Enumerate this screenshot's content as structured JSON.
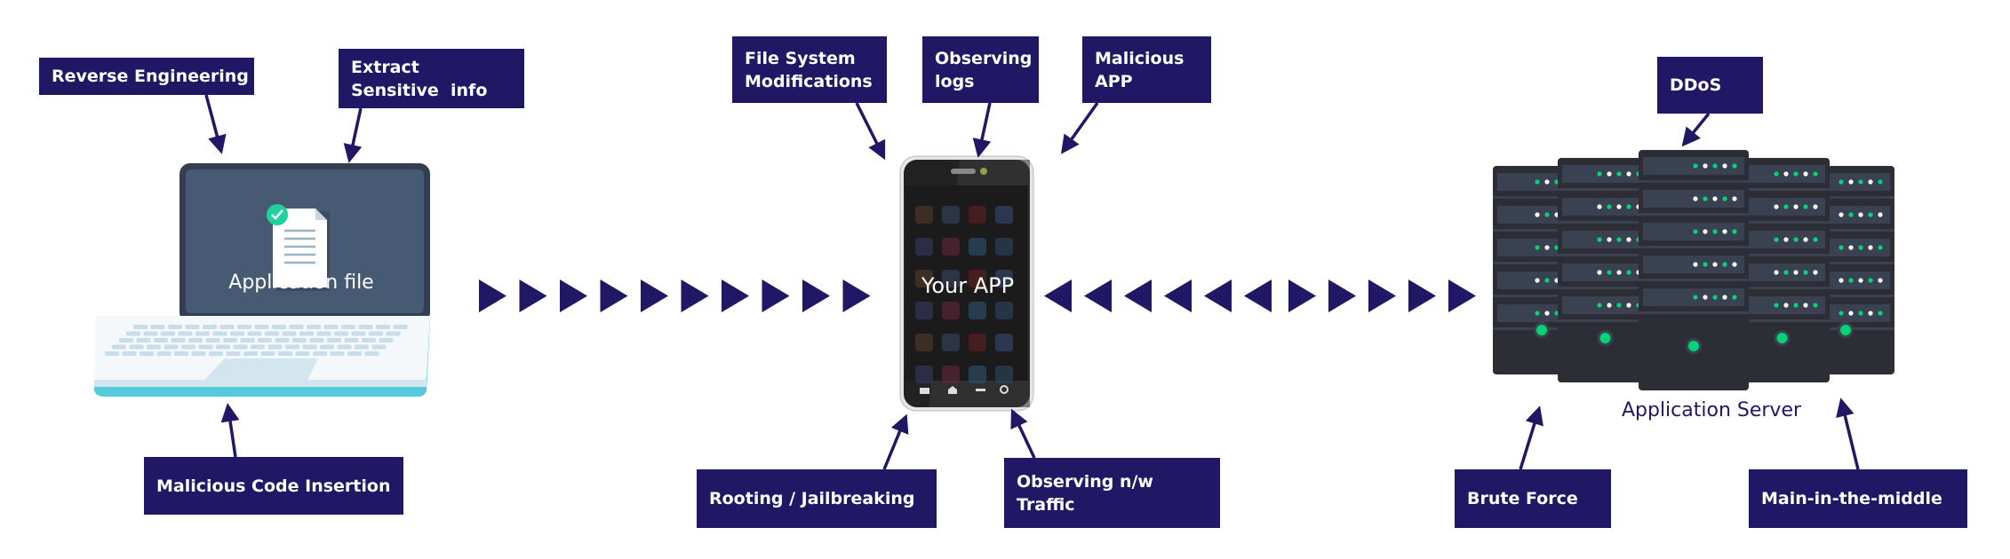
{
  "colors": {
    "label_bg": "#201865",
    "arrow": "#201865",
    "laptop_screen": "#475a73",
    "laptop_frame": "#323f52",
    "laptop_base": "#55cadb",
    "server_body": "#2c2d35",
    "server_led": "#00d474"
  },
  "laptop": {
    "screen_label": "Application file",
    "icons": [
      "document-icon",
      "check-badge-icon"
    ]
  },
  "phone": {
    "screen_label": "Your APP"
  },
  "server": {
    "label": "Application Server"
  },
  "labels": {
    "reverse_engineering": [
      "Reverse Engineering"
    ],
    "extract_info": [
      "Extract",
      "Sensitive  info"
    ],
    "malicious_code": [
      "Malicious Code Insertion"
    ],
    "file_system": [
      "File System",
      "Modifications"
    ],
    "observing_logs": [
      "Observing",
      "logs"
    ],
    "malicious_app": [
      "Malicious",
      "APP"
    ],
    "rooting": [
      "Rooting / Jailbreaking"
    ],
    "observing_traffic": [
      "Observing n/w",
      "Traffic"
    ],
    "ddos": [
      "DDoS"
    ],
    "brute_force": [
      "Brute Force"
    ],
    "mitm": [
      "Main-in-the-middle"
    ]
  }
}
